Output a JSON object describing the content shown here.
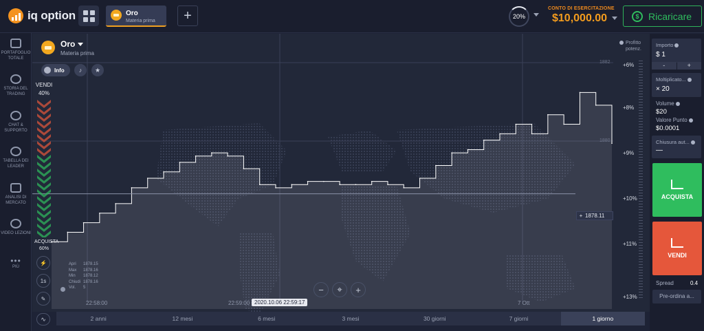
{
  "header": {
    "logo_text": "iq option",
    "tab": {
      "title": "Oro",
      "subtitle": "Materia prima"
    },
    "add_label": "+",
    "percent": "20%",
    "account_label": "CONTO DI ESERCITAZIONE",
    "account_value": "$10,000.00",
    "topup_label": "Ricaricare"
  },
  "sidebar": {
    "items": [
      {
        "label": "PORTAFOGLIO TOTALE",
        "icon": "briefcase-icon"
      },
      {
        "label": "STORIA DEL TRADING",
        "icon": "history-icon"
      },
      {
        "label": "CHAT & SUPPORTO",
        "icon": "chat-icon"
      },
      {
        "label": "TABELLA DEI LEADER",
        "icon": "trophy-icon"
      },
      {
        "label": "ANALISI DI MERCATO",
        "icon": "news-icon"
      },
      {
        "label": "VIDEO LEZIONI",
        "icon": "play-icon"
      },
      {
        "label": "PIÙ",
        "icon": "more-icon"
      }
    ]
  },
  "asset": {
    "name": "Oro",
    "type": "Materia prima",
    "info_label": "Info"
  },
  "sentiment": {
    "sell_label": "VENDI",
    "sell_pct": "40%",
    "buy_label": "ACQUISTA",
    "buy_pct": "60%",
    "sell_share": 0.4,
    "buy_share": 0.6
  },
  "ohlc": {
    "rows": [
      {
        "k": "Apri",
        "v": "1878.15"
      },
      {
        "k": "Max",
        "v": "1878.16"
      },
      {
        "k": "Min",
        "v": "1878.12"
      },
      {
        "k": "Chiudi",
        "v": "1878.16"
      },
      {
        "k": "Vol.",
        "v": "5"
      }
    ]
  },
  "tools": {
    "interval": "1s"
  },
  "time_axis": {
    "ticks": [
      "22:58:00",
      "22:59:00",
      "7 Ott"
    ],
    "cursor": "2020.10.06 22:59:17"
  },
  "price_axis": {
    "ticks": [
      "1882",
      "1880"
    ],
    "current": "1878.11"
  },
  "profit": {
    "title_1": "Profitto",
    "title_2": "potenz.",
    "ticks": [
      "+6%",
      "+8%",
      "+9%",
      "+10%",
      "+11%",
      "+13%"
    ]
  },
  "ranges": [
    "2 anni",
    "12 mesi",
    "6 mesi",
    "3 mesi",
    "30 giorni",
    "7 giorni",
    "1 giorno"
  ],
  "active_range": "1 giorno",
  "panel": {
    "amount_label": "Importo",
    "amount_value": "$  1",
    "minus": "-",
    "plus": "+",
    "multiplier_label": "Moltiplicato...",
    "multiplier_value": "× 20",
    "volume_label": "Volume",
    "volume_value": "$20",
    "point_label": "Valore Punto",
    "point_value": "$0.0001",
    "auto_close_label": "Chiusura aut...",
    "auto_close_value": "—",
    "buy_label": "ACQUISTA",
    "sell_label": "VENDI",
    "spread_label": "Spread",
    "spread_value": "0.4",
    "preorder_label": "Pre-ordina a..."
  },
  "colors": {
    "buy": "#2fbd5e",
    "sell": "#e5573b",
    "accent": "#f39c1e",
    "line": "#ffffff"
  },
  "chart_data": {
    "type": "area",
    "x": [
      "22:57:35",
      "22:57:40",
      "22:57:45",
      "22:57:50",
      "22:57:55",
      "22:58:00",
      "22:58:05",
      "22:58:10",
      "22:58:15",
      "22:58:20",
      "22:58:25",
      "22:58:30",
      "22:58:35",
      "22:58:40",
      "22:58:45",
      "22:58:50",
      "22:58:55",
      "22:59:00",
      "22:59:05",
      "22:59:10",
      "22:59:15",
      "22:59:20",
      "22:59:25",
      "22:59:30",
      "22:59:35",
      "22:59:40",
      "22:59:45",
      "22:59:50",
      "22:59:55",
      "23:00:00",
      "23:00:05",
      "23:00:10",
      "23:00:15",
      "23:00:20",
      "23:00:25",
      "23:00:30"
    ],
    "series": [
      {
        "values": [
          1876.6,
          1876.9,
          1877.2,
          1877.5,
          1877.8,
          1878.3,
          1878.6,
          1878.8,
          1879.1,
          1879.3,
          1879.4,
          1879.3,
          1878.9,
          1878.4,
          1878.3,
          1878.4,
          1878.5,
          1878.5,
          1878.4,
          1878.4,
          1878.5,
          1878.4,
          1878.3,
          1878.6,
          1879.0,
          1879.4,
          1879.5,
          1879.8,
          1880.0,
          1880.3,
          1880.0,
          1880.6,
          1880.3,
          1881.3,
          1880.9,
          1879.7
        ]
      }
    ],
    "y_range": [
      1876.0,
      1882.5
    ],
    "grid": true
  }
}
